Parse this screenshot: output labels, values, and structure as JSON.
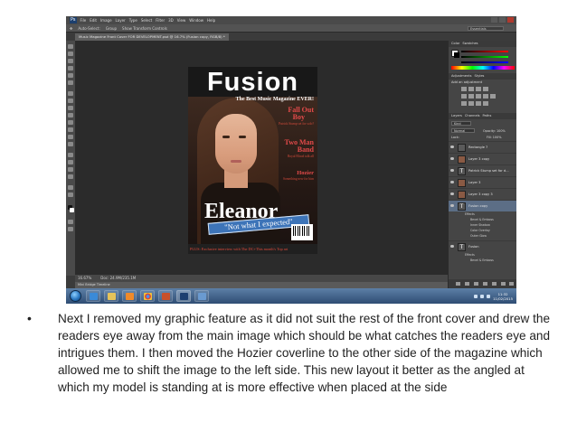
{
  "photoshop": {
    "logo": "Ps",
    "menu": [
      "File",
      "Edit",
      "Image",
      "Layer",
      "Type",
      "Select",
      "Filter",
      "3D",
      "View",
      "Window",
      "Help"
    ],
    "options": [
      "Auto-Select:",
      "Group",
      "Show Transform Controls"
    ],
    "workspace": "Essentials",
    "document_tab": "Music Magazine Front Cover FOR DEVELOPMENT.psd @ 16.7% (Fusion copy, RGB/8) *",
    "status_zoom": "16.67%",
    "status_doc": "Doc: 24.9M/235.1M",
    "mini_bridge": "Mini Bridge   Timeline",
    "panel_tabs_top": [
      "Color",
      "Swatches"
    ],
    "panel_tabs_adj": [
      "Adjustments",
      "Styles"
    ],
    "add_adjustment": "Add an adjustment",
    "panel_tabs_layers": [
      "Layers",
      "Channels",
      "Paths"
    ],
    "layer_kind": "Kind",
    "blend_mode": "Normal",
    "opacity": "Opacity: 100%",
    "fill": "Fill: 100%",
    "lock": "Lock:",
    "layers": [
      {
        "name": "Rectangle 7",
        "type": "shape"
      },
      {
        "name": "Layer 3 copy",
        "type": "image"
      },
      {
        "name": "Patrick Stump set for d...",
        "type": "text"
      },
      {
        "name": "Layer 3",
        "type": "image"
      },
      {
        "name": "Layer 3 copy 3",
        "type": "image"
      },
      {
        "name": "Fusion copy",
        "type": "text",
        "selected": true
      },
      {
        "name": "Fusion",
        "type": "text"
      }
    ],
    "effects_label": "Effects",
    "effects": [
      "Bevel & Emboss",
      "Inner Shadow",
      "Color Overlay",
      "Outer Glow"
    ],
    "effects2": [
      "Effects",
      "Bevel & Emboss"
    ]
  },
  "cover": {
    "masthead": "Fusion",
    "tagline": "The Best Music Magazine EVER!",
    "coverlines": [
      {
        "head": "Fall Out",
        "head2": "Boy",
        "sub": "Patrick Stump set for solo?"
      },
      {
        "head": "Two Man",
        "head2": "Band",
        "sub": "Royal Blood talk all"
      },
      {
        "head": "Hozier",
        "sub": "Something new for him"
      }
    ],
    "name": "Eleanor",
    "subname": "\"Not what I expected\"",
    "strap": "PLUS: Exclusive interview with The DC+This month's Top art"
  },
  "taskbar": {
    "time": "11:32",
    "date": "11/02/2015"
  },
  "caption": "Next I removed my graphic feature as it did not suit the rest of the front cover and drew the readers eye away from the main image which should be what catches the readers eye and intrigues them. I then moved the Hozier coverline to the other side of the magazine which allowed me to shift the image to the left side. This new layout it better as the angled at which my model is standing at is more effective when placed at the side",
  "colors": {
    "masthead": "#ffffff",
    "coverline_red": "#e34a4a",
    "subname_blue": "#3d74b8",
    "selected_layer": "#5c6e86"
  }
}
